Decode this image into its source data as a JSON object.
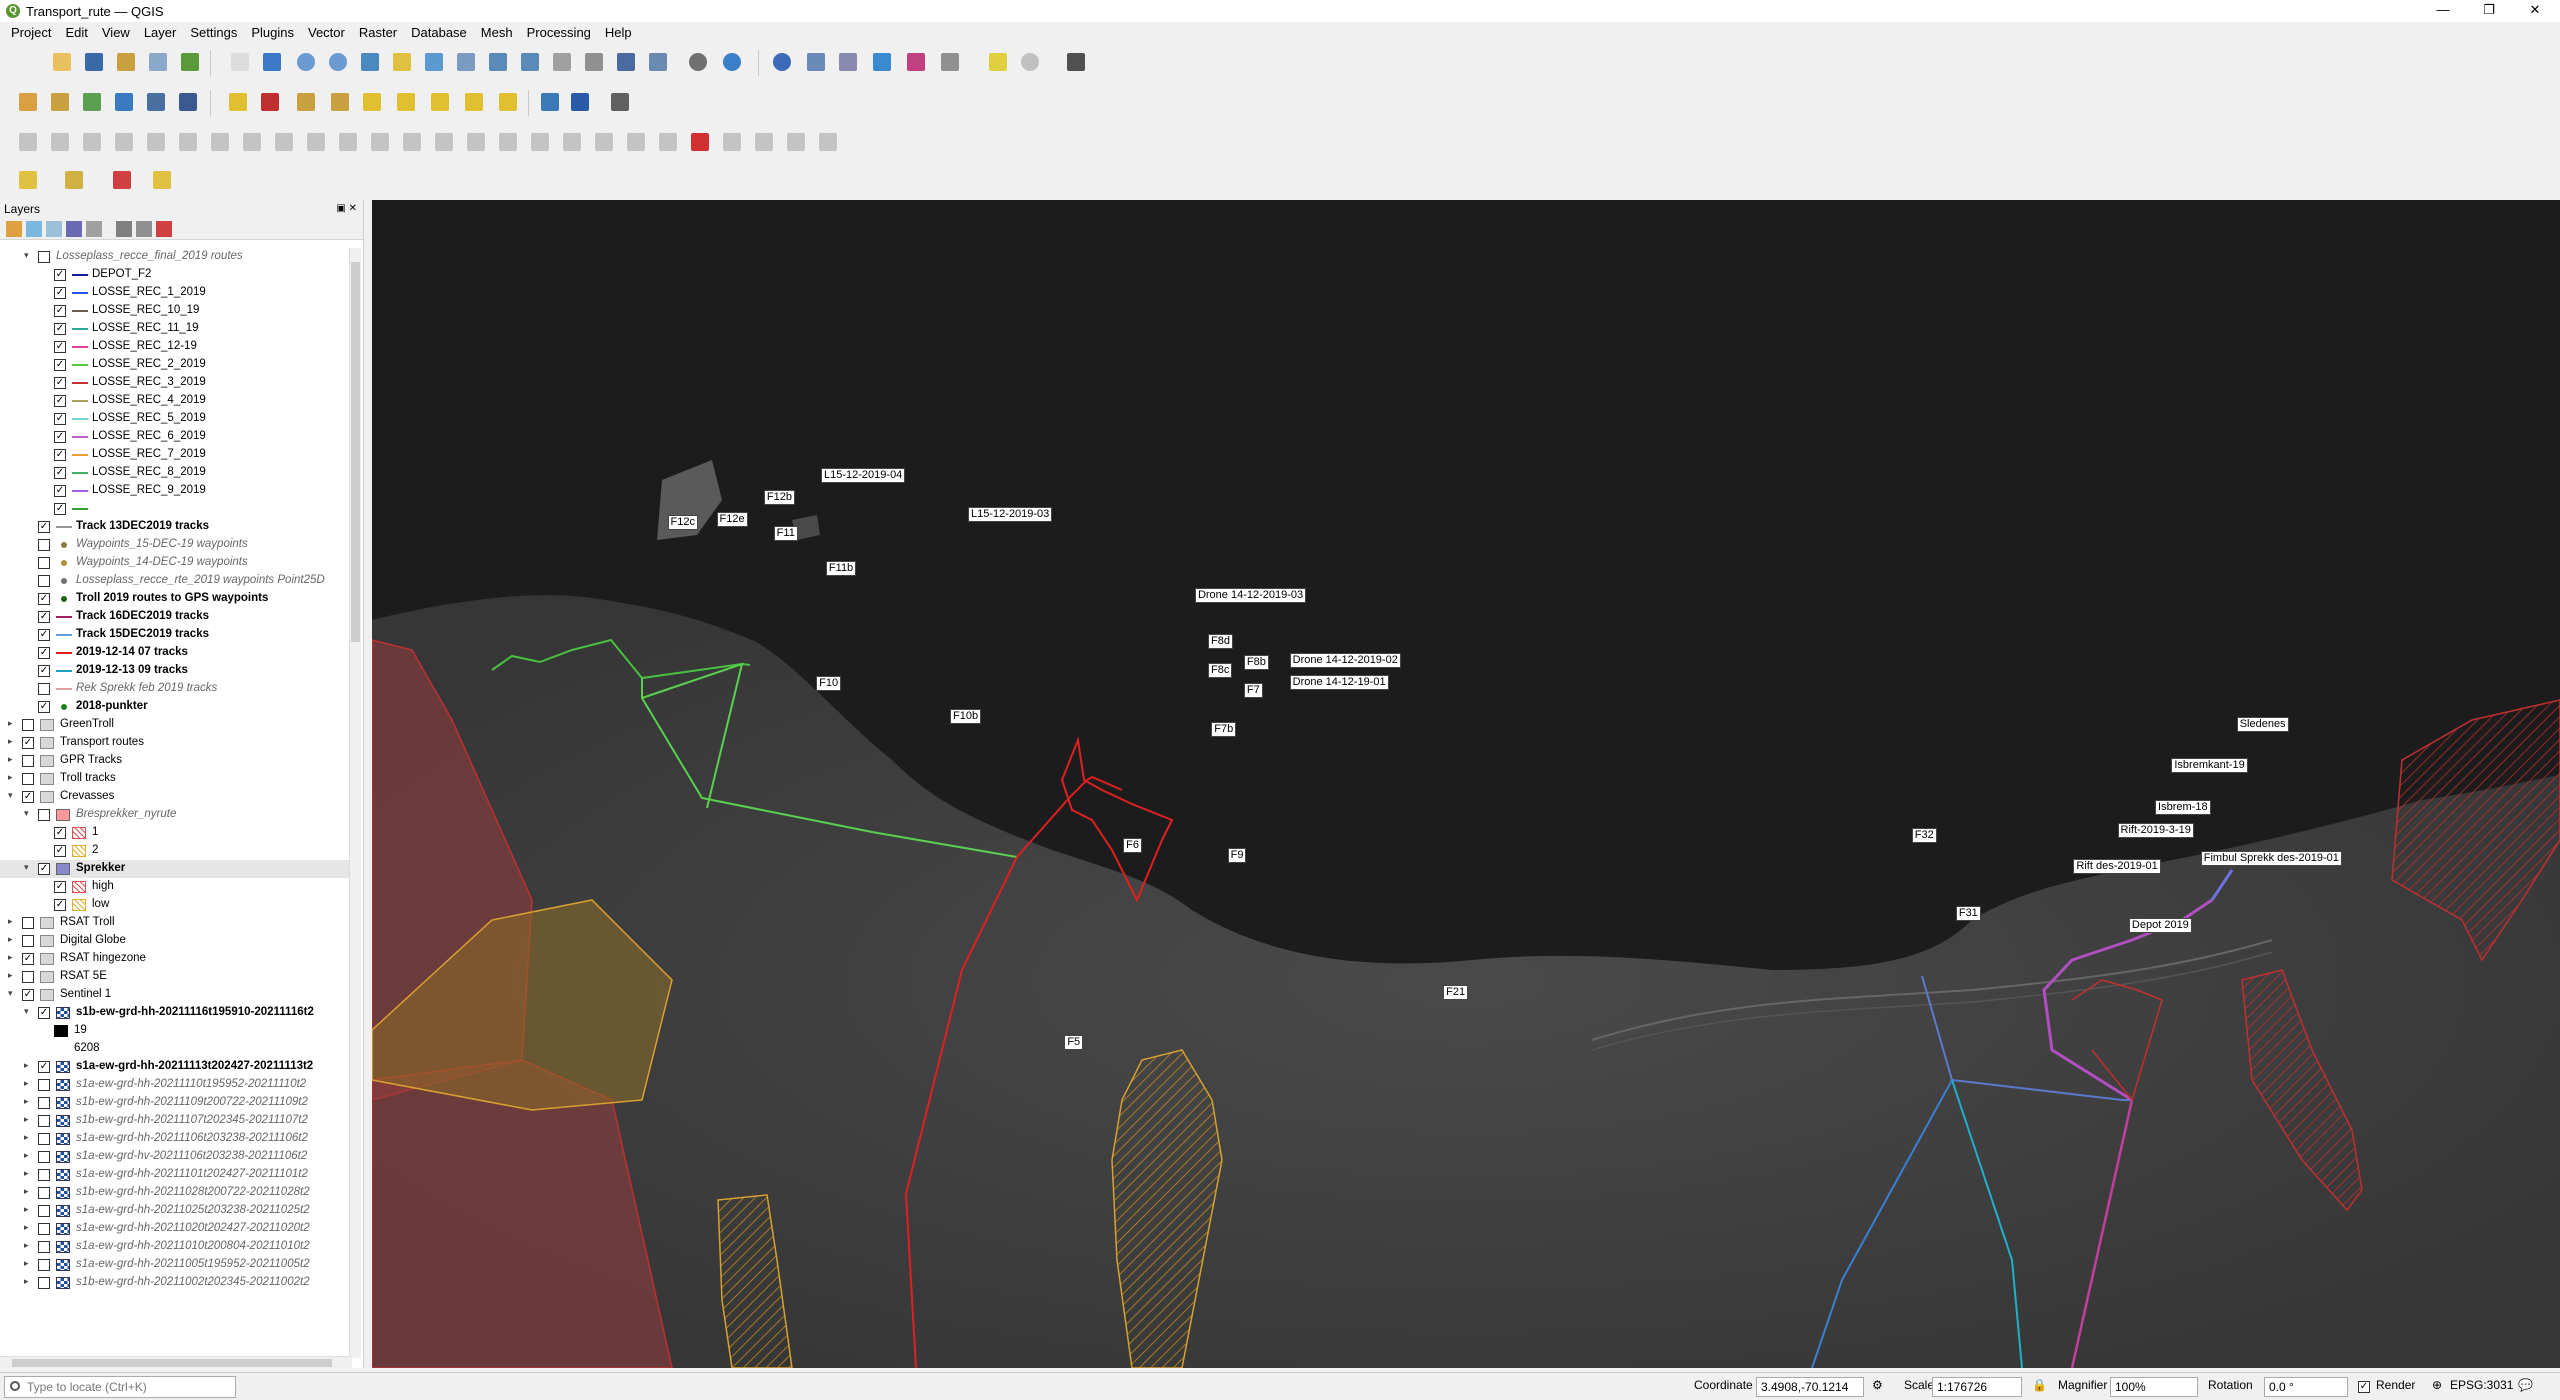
{
  "window": {
    "title": "Transport_rute — QGIS",
    "minimize": "—",
    "maximize": "❐",
    "close": "✕"
  },
  "menu": [
    "Project",
    "Edit",
    "View",
    "Layer",
    "Settings",
    "Plugins",
    "Vector",
    "Raster",
    "Database",
    "Mesh",
    "Processing",
    "Help"
  ],
  "layers_panel": {
    "title": "Layers",
    "items": [
      {
        "label": "Losseplass_recce_final_2019 routes",
        "indent": 2,
        "check": "",
        "style": "ital",
        "sym": "none",
        "exp": "▾"
      },
      {
        "label": "DEPOT_F2",
        "indent": 3,
        "check": "✓",
        "sym": "line",
        "color": "#1a1aa0"
      },
      {
        "label": "LOSSE_REC_1_2019",
        "indent": 3,
        "check": "✓",
        "sym": "line",
        "color": "#2a54ff"
      },
      {
        "label": "LOSSE_REC_10_19",
        "indent": 3,
        "check": "✓",
        "sym": "line",
        "color": "#6a5a4a"
      },
      {
        "label": "LOSSE_REC_11_19",
        "indent": 3,
        "check": "✓",
        "sym": "line",
        "color": "#2aa9a0"
      },
      {
        "label": "LOSSE_REC_12-19",
        "indent": 3,
        "check": "✓",
        "sym": "line",
        "color": "#e04090"
      },
      {
        "label": "LOSSE_REC_2_2019",
        "indent": 3,
        "check": "✓",
        "sym": "line",
        "color": "#5ac83a"
      },
      {
        "label": "LOSSE_REC_3_2019",
        "indent": 3,
        "check": "✓",
        "sym": "line",
        "color": "#c83030"
      },
      {
        "label": "LOSSE_REC_4_2019",
        "indent": 3,
        "check": "✓",
        "sym": "line",
        "color": "#b0a060"
      },
      {
        "label": "LOSSE_REC_5_2019",
        "indent": 3,
        "check": "✓",
        "sym": "line",
        "color": "#70d8c8"
      },
      {
        "label": "LOSSE_REC_6_2019",
        "indent": 3,
        "check": "✓",
        "sym": "line",
        "color": "#c060c8"
      },
      {
        "label": "LOSSE_REC_7_2019",
        "indent": 3,
        "check": "✓",
        "sym": "line",
        "color": "#f0a030"
      },
      {
        "label": "LOSSE_REC_8_2019",
        "indent": 3,
        "check": "✓",
        "sym": "line",
        "color": "#40b060"
      },
      {
        "label": "LOSSE_REC_9_2019",
        "indent": 3,
        "check": "✓",
        "sym": "line",
        "color": "#9a60e0"
      },
      {
        "label": "",
        "indent": 3,
        "check": "✓",
        "sym": "line",
        "color": "#30a030"
      },
      {
        "label": "Track 13DEC2019 tracks",
        "indent": 2,
        "check": "✓",
        "style": "bold",
        "sym": "line",
        "color": "#999999"
      },
      {
        "label": "Waypoints_15-DEC-19 waypoints",
        "indent": 2,
        "check": "",
        "style": "ital",
        "sym": "dot",
        "color": "#8a7a40"
      },
      {
        "label": "Waypoints_14-DEC-19 waypoints",
        "indent": 2,
        "check": "",
        "style": "ital",
        "sym": "dot",
        "color": "#b09040"
      },
      {
        "label": "Losseplass_recce_rte_2019 waypoints Point25D",
        "indent": 2,
        "check": "",
        "style": "ital",
        "sym": "dot",
        "color": "#707070"
      },
      {
        "label": "Troll 2019 routes to GPS waypoints",
        "indent": 2,
        "check": "✓",
        "style": "bold",
        "sym": "dot",
        "color": "#206020"
      },
      {
        "label": "Track 16DEC2019 tracks",
        "indent": 2,
        "check": "✓",
        "style": "bold",
        "sym": "line",
        "color": "#a02060"
      },
      {
        "label": "Track 15DEC2019 tracks",
        "indent": 2,
        "check": "✓",
        "style": "bold",
        "sym": "line",
        "color": "#60a0d0"
      },
      {
        "label": "2019-12-14 07 tracks",
        "indent": 2,
        "check": "✓",
        "style": "bold",
        "sym": "line",
        "color": "#e02020"
      },
      {
        "label": "2019-12-13 09 tracks",
        "indent": 2,
        "check": "✓",
        "style": "bold",
        "sym": "line",
        "color": "#20a0c0"
      },
      {
        "label": "Rek Sprekk feb 2019 tracks",
        "indent": 2,
        "check": "",
        "style": "ital",
        "sym": "line",
        "color": "#e0a0a0"
      },
      {
        "label": "2018-punkter",
        "indent": 2,
        "check": "✓",
        "style": "bold",
        "sym": "dot",
        "color": "#208020"
      },
      {
        "label": "GreenTroll",
        "indent": 1,
        "check": "",
        "sym": "group",
        "exp": "▸"
      },
      {
        "label": "Transport routes",
        "indent": 1,
        "check": "✓",
        "sym": "group",
        "exp": "▸"
      },
      {
        "label": "GPR Tracks",
        "indent": 1,
        "check": "",
        "sym": "group",
        "exp": "▸"
      },
      {
        "label": "Troll tracks",
        "indent": 1,
        "check": "",
        "sym": "group",
        "exp": "▸"
      },
      {
        "label": "Crevasses",
        "indent": 1,
        "check": "✓",
        "sym": "group",
        "exp": "▾"
      },
      {
        "label": "Bresprekker_nyrute",
        "indent": 2,
        "check": "",
        "style": "ital",
        "sym": "poly",
        "exp": "▾",
        "color": "#ff9999"
      },
      {
        "label": "1",
        "indent": 3,
        "check": "✓",
        "sym": "hatch",
        "color": "#e05050"
      },
      {
        "label": "2",
        "indent": 3,
        "check": "✓",
        "sym": "hatch",
        "color": "#e0b030"
      },
      {
        "label": "Sprekker",
        "indent": 2,
        "check": "✓",
        "style": "bold",
        "sym": "poly",
        "exp": "▾",
        "sel": true,
        "color": "#8888cc"
      },
      {
        "label": "high",
        "indent": 3,
        "check": "✓",
        "sym": "hatch",
        "color": "#e05050"
      },
      {
        "label": "low",
        "indent": 3,
        "check": "✓",
        "sym": "hatch",
        "color": "#e0b030"
      },
      {
        "label": "RSAT Troll",
        "indent": 1,
        "check": "",
        "sym": "group",
        "exp": "▸"
      },
      {
        "label": "Digital Globe",
        "indent": 1,
        "check": "",
        "sym": "group",
        "exp": "▸"
      },
      {
        "label": "RSAT hingezone",
        "indent": 1,
        "check": "✓",
        "sym": "group",
        "exp": "▸"
      },
      {
        "label": "RSAT 5E",
        "indent": 1,
        "check": "",
        "sym": "group",
        "exp": "▸"
      },
      {
        "label": "Sentinel 1",
        "indent": 1,
        "check": "✓",
        "sym": "group",
        "exp": "▾"
      },
      {
        "label": "s1b-ew-grd-hh-20211116t195910-20211116t2",
        "indent": 2,
        "check": "✓",
        "style": "bold",
        "sym": "raster",
        "exp": "▾"
      },
      {
        "label": "19",
        "indent": 3,
        "check": "",
        "sym": "swatch",
        "color": "#000000"
      },
      {
        "label": "6208",
        "indent": 3,
        "check": "",
        "sym": "none"
      },
      {
        "label": "s1a-ew-grd-hh-20211113t202427-20211113t2",
        "indent": 2,
        "check": "✓",
        "style": "bold",
        "sym": "raster",
        "exp": "▸"
      },
      {
        "label": "s1a-ew-grd-hh-20211110t195952-20211110t2",
        "indent": 2,
        "check": "",
        "style": "ital",
        "sym": "raster",
        "exp": "▸"
      },
      {
        "label": "s1b-ew-grd-hh-20211109t200722-20211109t2",
        "indent": 2,
        "check": "",
        "style": "ital",
        "sym": "raster",
        "exp": "▸"
      },
      {
        "label": "s1b-ew-grd-hh-20211107t202345-20211107t2",
        "indent": 2,
        "check": "",
        "style": "ital",
        "sym": "raster",
        "exp": "▸"
      },
      {
        "label": "s1a-ew-grd-hh-20211106t203238-20211106t2",
        "indent": 2,
        "check": "",
        "style": "ital",
        "sym": "raster",
        "exp": "▸"
      },
      {
        "label": "s1a-ew-grd-hv-20211106t203238-20211106t2",
        "indent": 2,
        "check": "",
        "style": "ital",
        "sym": "raster",
        "exp": "▸"
      },
      {
        "label": "s1a-ew-grd-hh-20211101t202427-20211101t2",
        "indent": 2,
        "check": "",
        "style": "ital",
        "sym": "raster",
        "exp": "▸"
      },
      {
        "label": "s1b-ew-grd-hh-20211028t200722-20211028t2",
        "indent": 2,
        "check": "",
        "style": "ital",
        "sym": "raster",
        "exp": "▸"
      },
      {
        "label": "s1a-ew-grd-hh-20211025t203238-20211025t2",
        "indent": 2,
        "check": "",
        "style": "ital",
        "sym": "raster",
        "exp": "▸"
      },
      {
        "label": "s1a-ew-grd-hh-20211020t202427-20211020t2",
        "indent": 2,
        "check": "",
        "style": "ital",
        "sym": "raster",
        "exp": "▸"
      },
      {
        "label": "s1a-ew-grd-hh-20211010t200804-20211010t2",
        "indent": 2,
        "check": "",
        "style": "ital",
        "sym": "raster",
        "exp": "▸"
      },
      {
        "label": "s1a-ew-grd-hh-20211005t195952-20211005t2",
        "indent": 2,
        "check": "",
        "style": "ital",
        "sym": "raster",
        "exp": "▸"
      },
      {
        "label": "s1b-ew-grd-hh-20211002t202345-20211002t2",
        "indent": 2,
        "check": "",
        "style": "ital",
        "sym": "raster",
        "exp": "▸"
      }
    ]
  },
  "map_labels": [
    {
      "text": "L15-12-2019-04"
    },
    {
      "text": "L15-12-2019-03"
    },
    {
      "text": "F12b"
    },
    {
      "text": "F12c"
    },
    {
      "text": "F12e"
    },
    {
      "text": "F11"
    },
    {
      "text": "F11b"
    },
    {
      "text": "F10"
    },
    {
      "text": "F10b"
    },
    {
      "text": "Drone 14-12-2019-03"
    },
    {
      "text": "F8d"
    },
    {
      "text": "F8b"
    },
    {
      "text": "F8c"
    },
    {
      "text": "F7"
    },
    {
      "text": "Drone 14-12-2019-02"
    },
    {
      "text": "Drone 14-12-19-01"
    },
    {
      "text": "F7b"
    },
    {
      "text": "F6"
    },
    {
      "text": "F9"
    },
    {
      "text": "F5"
    },
    {
      "text": "F21"
    },
    {
      "text": "F32"
    },
    {
      "text": "F31"
    },
    {
      "text": "Sledenes"
    },
    {
      "text": "Isbremkant-19"
    },
    {
      "text": "Isbrem-18"
    },
    {
      "text": "Rift-2019-3-19"
    },
    {
      "text": "Rift des-2019-01"
    },
    {
      "text": "Fimbul Sprekk des-2019-01"
    },
    {
      "text": "Depot 2019"
    }
  ],
  "status": {
    "locator_placeholder": "Type to locate (Ctrl+K)",
    "coordinate_label": "Coordinate",
    "coordinate": "3.4908,-70.1214",
    "scale_label": "Scale",
    "scale": "1:176726",
    "magnifier_label": "Magnifier",
    "magnifier": "100%",
    "rotation_label": "Rotation",
    "rotation": "0.0 °",
    "render_label": "Render",
    "crs": "EPSG:3031"
  }
}
